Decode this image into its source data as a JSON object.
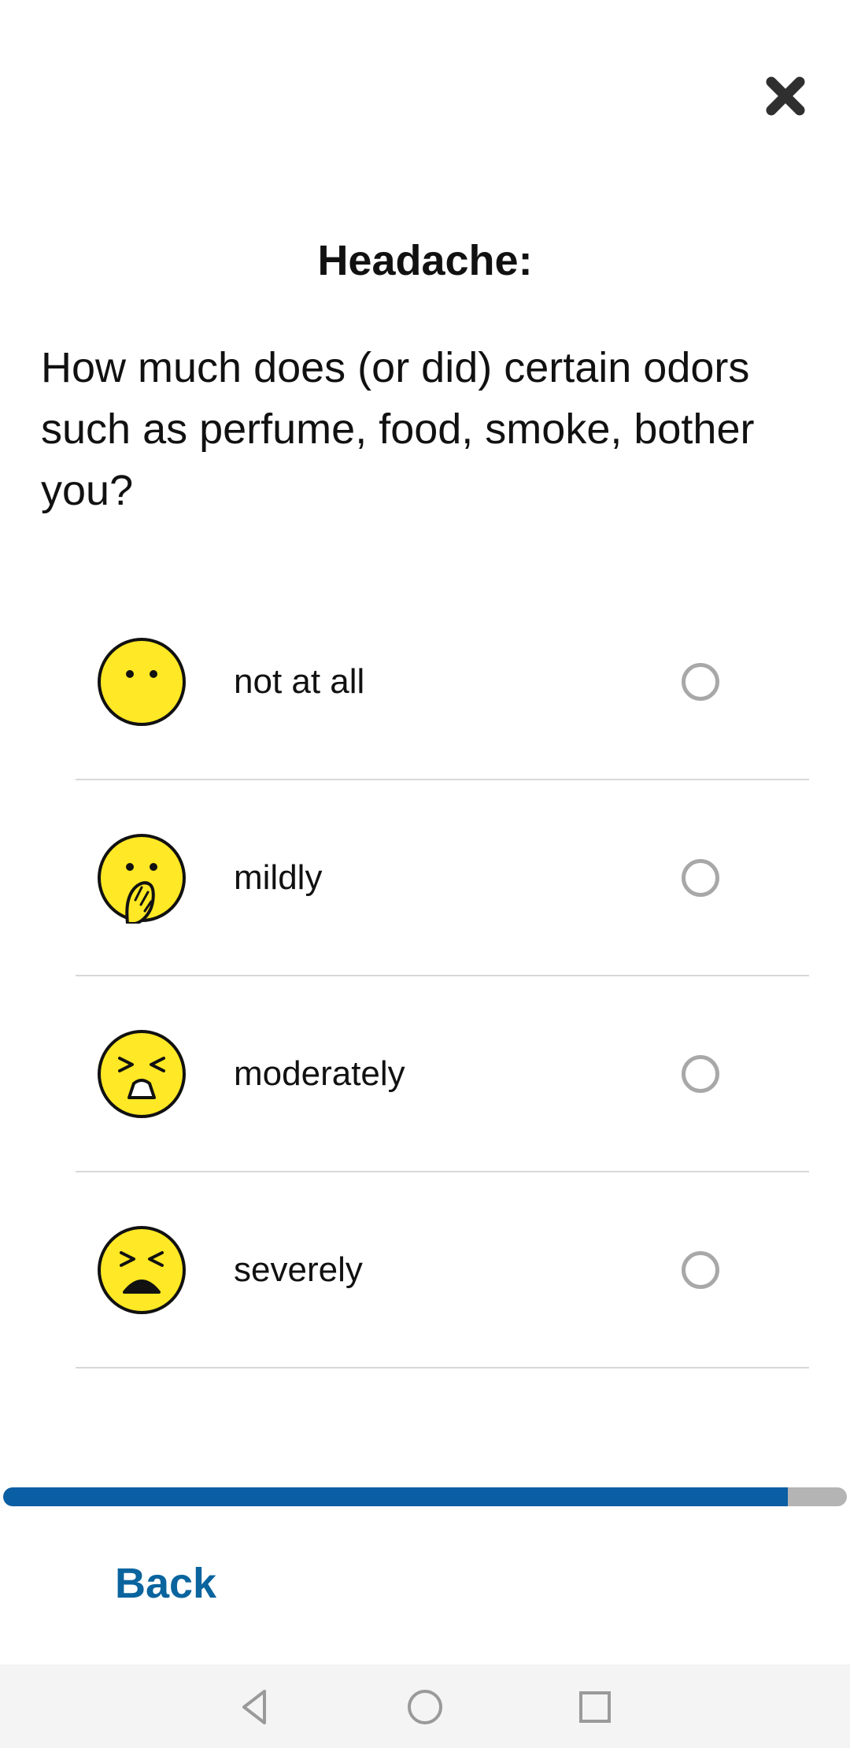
{
  "header": {
    "close_icon": "close-icon"
  },
  "title": "Headache:",
  "question": "How much does (or did) certain odors such as perfume, food, smoke, bother you?",
  "options": [
    {
      "label": "not at all",
      "icon": "neutral-face-icon",
      "selected": false
    },
    {
      "label": "mildly",
      "icon": "hand-over-mouth-face-icon",
      "selected": false
    },
    {
      "label": "moderately",
      "icon": "squinting-gasp-face-icon",
      "selected": false
    },
    {
      "label": "severely",
      "icon": "tired-face-icon",
      "selected": false
    }
  ],
  "progress": {
    "percent": 93
  },
  "footer": {
    "back_label": "Back"
  },
  "navbar": {
    "back_icon": "nav-back-icon",
    "home_icon": "nav-home-icon",
    "recents_icon": "nav-recents-icon"
  },
  "colors": {
    "accent": "#0a5ea3",
    "link": "#0a649e",
    "emoji_yellow": "#ffe825",
    "radio_border": "#a8a8a8"
  }
}
